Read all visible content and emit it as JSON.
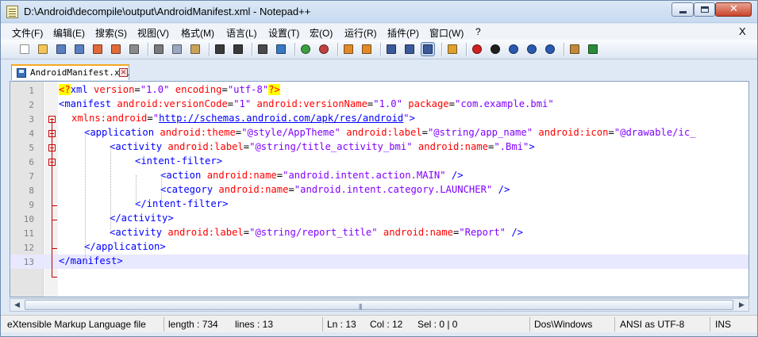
{
  "window": {
    "title": "D:\\Android\\decompile\\output\\AndroidManifest.xml - Notepad++",
    "menu_close": "X"
  },
  "menu": [
    "文件(F)",
    "编辑(E)",
    "搜索(S)",
    "视图(V)",
    "格式(M)",
    "语言(L)",
    "设置(T)",
    "宏(O)",
    "运行(R)",
    "插件(P)",
    "窗口(W)",
    "?"
  ],
  "toolbar": {
    "buttons": [
      {
        "name": "new-file-icon",
        "color": "#ffffff"
      },
      {
        "name": "open-file-icon",
        "color": "#f2c45a"
      },
      {
        "name": "save-icon",
        "color": "#5a7fc0"
      },
      {
        "name": "save-all-icon",
        "color": "#5a7fc0"
      },
      {
        "name": "close-file-icon",
        "color": "#e06a3a"
      },
      {
        "name": "close-all-icon",
        "color": "#e06a3a"
      },
      {
        "name": "print-icon",
        "color": "#8a8a8a"
      },
      {
        "name": "cut-icon",
        "color": "#7a7a7a"
      },
      {
        "name": "copy-icon",
        "color": "#9aa8c0"
      },
      {
        "name": "paste-icon",
        "color": "#c9a25a"
      },
      {
        "name": "undo-icon",
        "color": "#3a3a3a"
      },
      {
        "name": "redo-icon",
        "color": "#3a3a3a"
      },
      {
        "name": "find-icon",
        "color": "#4a4a4a"
      },
      {
        "name": "replace-icon",
        "color": "#3a79c0"
      },
      {
        "name": "zoom-in-icon",
        "color": "#3aa040"
      },
      {
        "name": "zoom-out-icon",
        "color": "#c04040"
      },
      {
        "name": "sync-vertical-icon",
        "color": "#e08a2a"
      },
      {
        "name": "sync-horizontal-icon",
        "color": "#e08a2a"
      },
      {
        "name": "word-wrap-icon",
        "color": "#3a5a9a"
      },
      {
        "name": "show-all-chars-icon",
        "color": "#3a5a9a"
      },
      {
        "name": "indent-guide-icon",
        "color": "#3a5a9a"
      },
      {
        "name": "language-icon",
        "color": "#e0a030"
      },
      {
        "name": "record-macro-icon",
        "color": "#d02020"
      },
      {
        "name": "stop-macro-icon",
        "color": "#202020"
      },
      {
        "name": "play-macro-icon",
        "color": "#2a5ab0"
      },
      {
        "name": "play-multiple-macro-icon",
        "color": "#2a5ab0"
      },
      {
        "name": "save-macro-icon",
        "color": "#2a5ab0"
      },
      {
        "name": "trim-icon",
        "color": "#c08a3a"
      },
      {
        "name": "spellcheck-icon",
        "color": "#2a8a3a"
      }
    ]
  },
  "tab": {
    "label": "AndroidManifest.xml"
  },
  "editor": {
    "current_line": 13,
    "lines": [
      {
        "n": "1"
      },
      {
        "n": "2"
      },
      {
        "n": "3"
      },
      {
        "n": "4"
      },
      {
        "n": "5"
      },
      {
        "n": "6"
      },
      {
        "n": "7"
      },
      {
        "n": "8"
      },
      {
        "n": "9"
      },
      {
        "n": "10"
      },
      {
        "n": "11"
      },
      {
        "n": "12"
      },
      {
        "n": "13"
      }
    ],
    "tokens": {
      "l1": [
        "<?",
        "xml",
        " version",
        "=",
        "\"1.0\"",
        " encoding",
        "=",
        "\"utf-8\"",
        "?>"
      ],
      "l2": [
        "<manifest",
        " android:versionCode",
        "=",
        "\"1\"",
        " android:versionName",
        "=",
        "\"1.0\"",
        " package",
        "=",
        "\"com.example.bmi\""
      ],
      "l3": [
        "xmlns:android",
        "=",
        "\"",
        "http://schemas.android.com/apk/res/android",
        "\"",
        ">"
      ],
      "l4": [
        "<application",
        " android:theme",
        "=",
        "\"@style/AppTheme\"",
        " android:label",
        "=",
        "\"@string/app_name\"",
        " android:icon",
        "=",
        "\"@drawable/ic_"
      ],
      "l5": [
        "<activity",
        " android:label",
        "=",
        "\"@string/title_activity_bmi\"",
        " android:name",
        "=",
        "\".Bmi\"",
        ">"
      ],
      "l6": [
        "<intent-filter",
        ">"
      ],
      "l7": [
        "<action",
        " android:name",
        "=",
        "\"android.intent.action.MAIN\"",
        " />"
      ],
      "l8": [
        "<category",
        " android:name",
        "=",
        "\"android.intent.category.LAUNCHER\"",
        " />"
      ],
      "l9": [
        "</intent-filter",
        ">"
      ],
      "l10": [
        "</activity",
        ">"
      ],
      "l11": [
        "<activity",
        " android:label",
        "=",
        "\"@string/report_title\"",
        " android:name",
        "=",
        "\"Report\"",
        " />"
      ],
      "l12": [
        "</application",
        ">"
      ],
      "l13": [
        "</manifest",
        ">"
      ]
    }
  },
  "scrollbar": {
    "left_arrow": "◀",
    "right_arrow": "▶",
    "grip": "|||"
  },
  "status": {
    "filetype": "eXtensible Markup Language file",
    "length": "length : 734",
    "lines": "lines : 13",
    "ln": "Ln : 13",
    "col": "Col : 12",
    "sel": "Sel : 0 | 0",
    "eol": "Dos\\Windows",
    "encoding": "ANSI as UTF-8",
    "mode": "INS"
  },
  "colors": {
    "tag": "#0000ff",
    "attribute": "#ff0000",
    "value": "#8000ff",
    "fold_marker": "#c40000",
    "active_tab_accent": "#f6a823",
    "current_line_bg": "#e8e8ff"
  }
}
